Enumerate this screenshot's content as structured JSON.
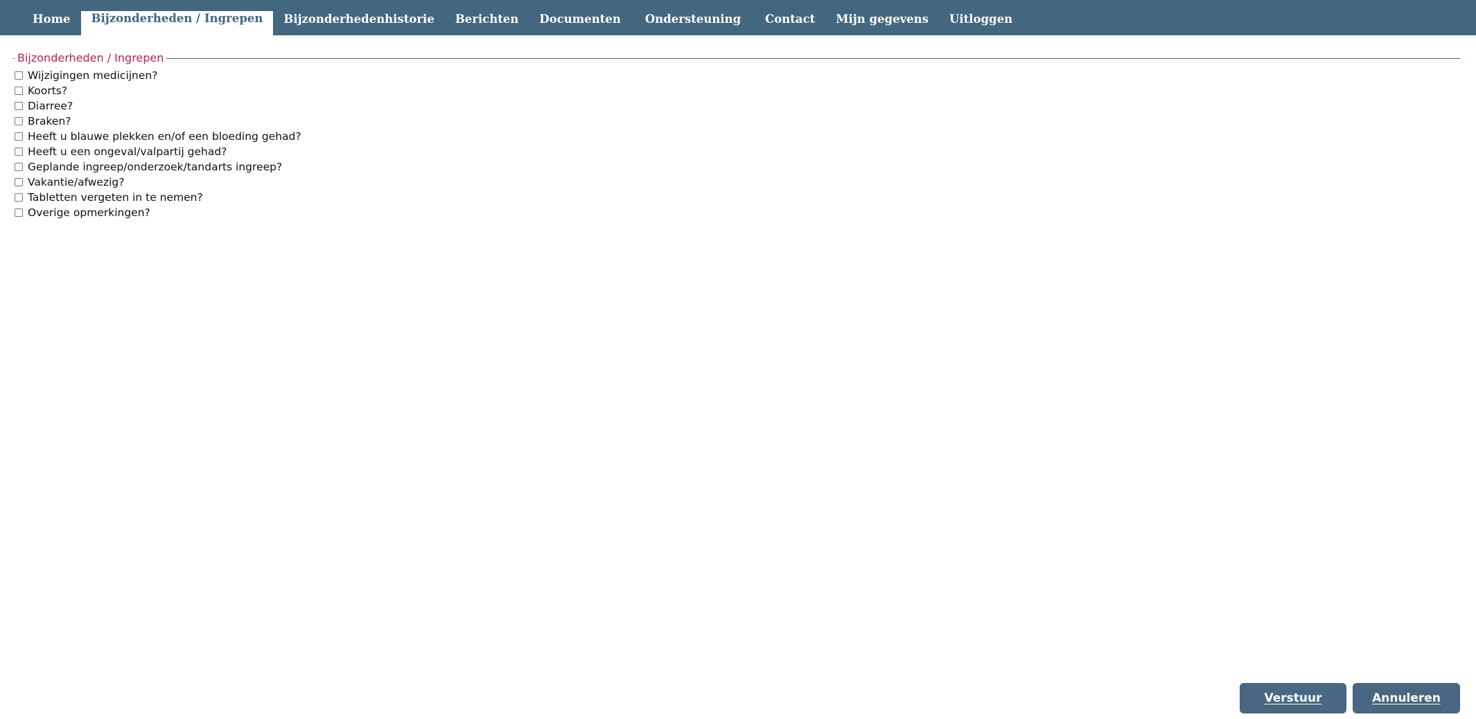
{
  "nav": {
    "tabs": [
      {
        "label": "Home"
      },
      {
        "label": "Bijzonderheden / Ingrepen",
        "active": true
      },
      {
        "label": "Bijzonderhedenhistorie"
      },
      {
        "label": "Berichten"
      },
      {
        "label": "Documenten"
      },
      {
        "label": "Ondersteuning"
      },
      {
        "label": "Contact"
      },
      {
        "label": "Mijn gegevens"
      },
      {
        "label": "Uitloggen"
      }
    ]
  },
  "form": {
    "legend": "Bijzonderheden / Ingrepen",
    "options": [
      {
        "label": "Wijzigingen medicijnen?",
        "checked": false
      },
      {
        "label": "Koorts?",
        "checked": false
      },
      {
        "label": "Diarree?",
        "checked": false
      },
      {
        "label": "Braken?",
        "checked": false
      },
      {
        "label": "Heeft u blauwe plekken en/of een bloeding gehad?",
        "checked": false
      },
      {
        "label": "Heeft u een ongeval/valpartij gehad?",
        "checked": false
      },
      {
        "label": "Geplande ingreep/onderzoek/tandarts ingreep?",
        "checked": false
      },
      {
        "label": "Vakantie/afwezig?",
        "checked": false
      },
      {
        "label": "Tabletten vergeten in te nemen?",
        "checked": false
      },
      {
        "label": "Overige opmerkingen?",
        "checked": false
      }
    ]
  },
  "actions": {
    "send_label": "Verstuur",
    "cancel_label": "Annuleren"
  },
  "colors": {
    "nav_bg": "#43677f",
    "legend_text": "#b0284b",
    "button_bg": "#476782"
  }
}
